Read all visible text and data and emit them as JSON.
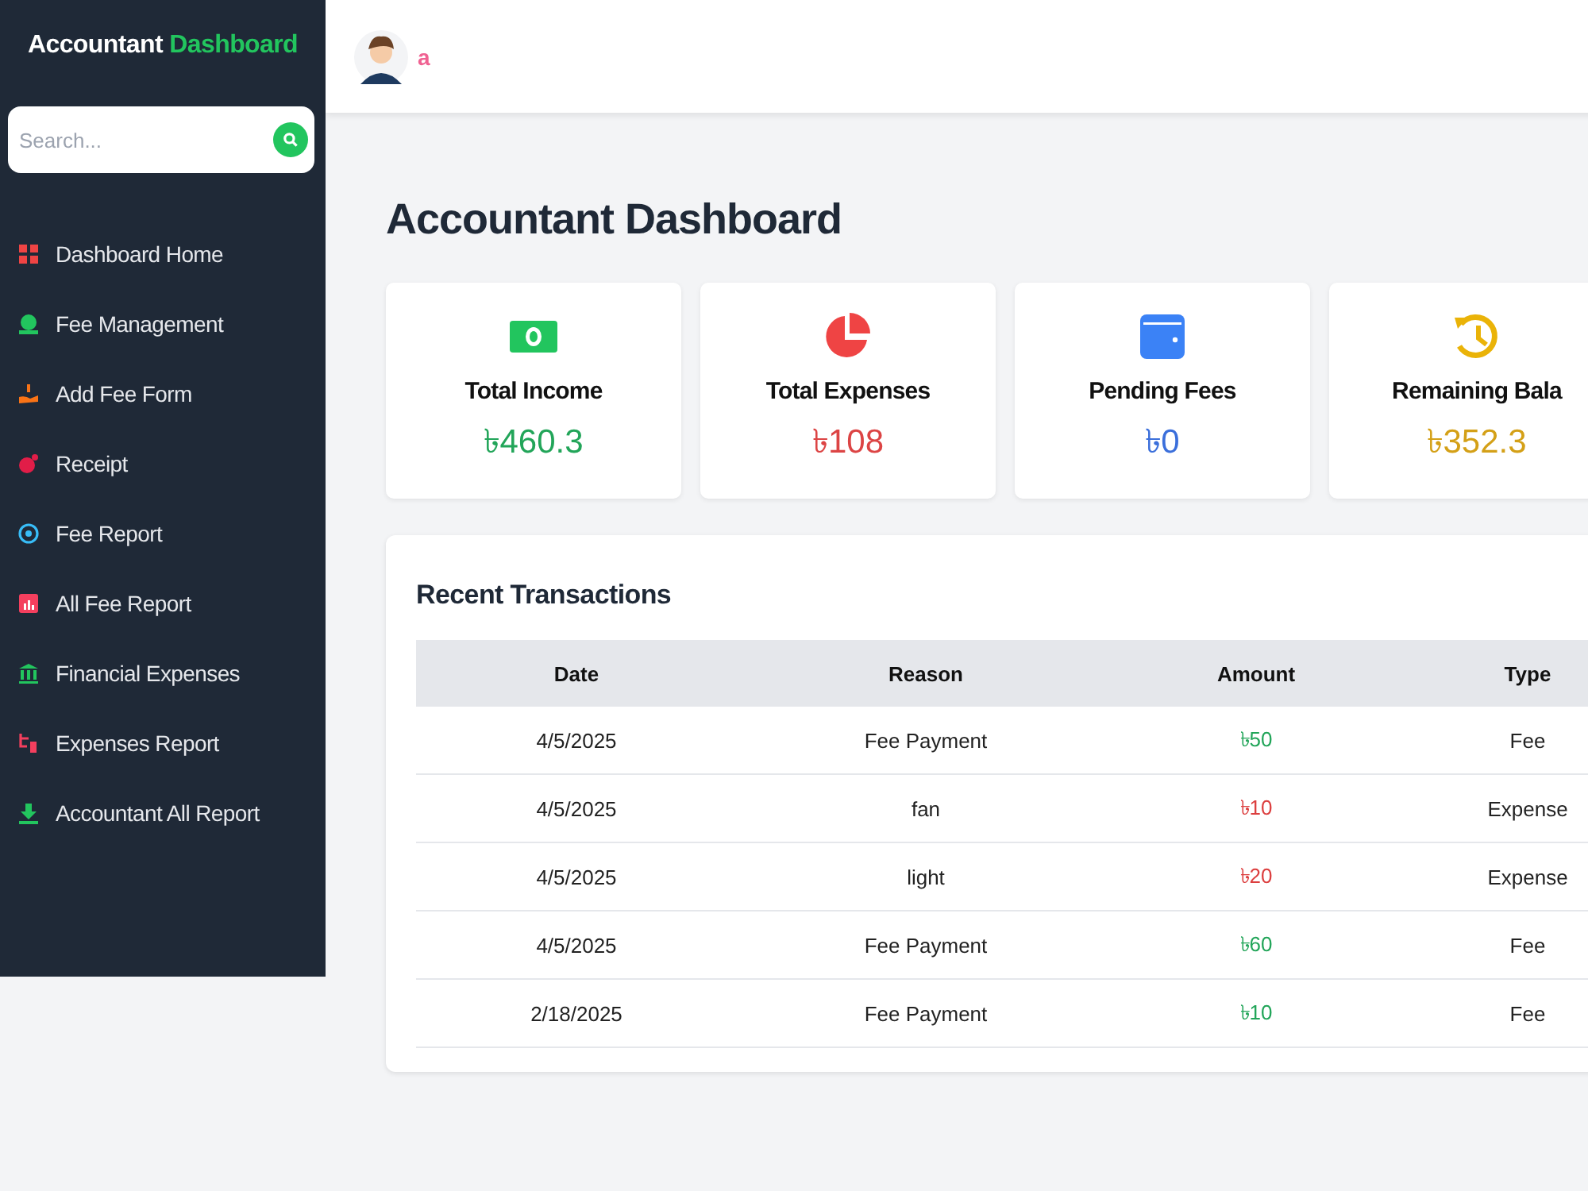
{
  "sidebar": {
    "brand": {
      "first": "Accountant",
      "second": "Dashboard"
    },
    "search": {
      "placeholder": "Search..."
    },
    "items": [
      {
        "label": "Dashboard Home",
        "kind": "grid",
        "color": "#ef4444"
      },
      {
        "label": "Fee Management",
        "kind": "money",
        "color": "#22c55e"
      },
      {
        "label": "Add Fee Form",
        "kind": "hand",
        "color": "#f97316"
      },
      {
        "label": "Receipt",
        "kind": "blob",
        "color": "#e11d48"
      },
      {
        "label": "Fee Report",
        "kind": "circle",
        "color": "#38bdf8"
      },
      {
        "label": "All Fee Report",
        "kind": "chart",
        "color": "#f43f5e"
      },
      {
        "label": "Financial Expenses",
        "kind": "bank",
        "color": "#22c55e"
      },
      {
        "label": "Expenses Report",
        "kind": "branch",
        "color": "#f43f5e"
      },
      {
        "label": "Accountant All Report",
        "kind": "download",
        "color": "#22c55e"
      }
    ]
  },
  "header": {
    "user": "a"
  },
  "title": "Accountant Dashboard",
  "cards": [
    {
      "label": "Total Income",
      "value": "৳460.3",
      "kind": "cash",
      "color": "#22a559"
    },
    {
      "label": "Total Expenses",
      "value": "৳108",
      "kind": "pie",
      "color": "#dc4444"
    },
    {
      "label": "Pending Fees",
      "value": "৳0",
      "kind": "wallet",
      "color": "#3b6fdb"
    },
    {
      "label": "Remaining Bala",
      "value": "৳352.3",
      "kind": "history",
      "color": "#d4a017"
    }
  ],
  "transactions": {
    "title": "Recent Transactions",
    "columns": [
      "Date",
      "Reason",
      "Amount",
      "Type"
    ],
    "rows": [
      {
        "date": "4/5/2025",
        "reason": "Fee Payment",
        "amount": "৳50",
        "type": "Fee",
        "kind": "fee"
      },
      {
        "date": "4/5/2025",
        "reason": "fan",
        "amount": "৳10",
        "type": "Expense",
        "kind": "expense"
      },
      {
        "date": "4/5/2025",
        "reason": "light",
        "amount": "৳20",
        "type": "Expense",
        "kind": "expense"
      },
      {
        "date": "4/5/2025",
        "reason": "Fee Payment",
        "amount": "৳60",
        "type": "Fee",
        "kind": "fee"
      },
      {
        "date": "2/18/2025",
        "reason": "Fee Payment",
        "amount": "৳10",
        "type": "Fee",
        "kind": "fee"
      }
    ]
  }
}
